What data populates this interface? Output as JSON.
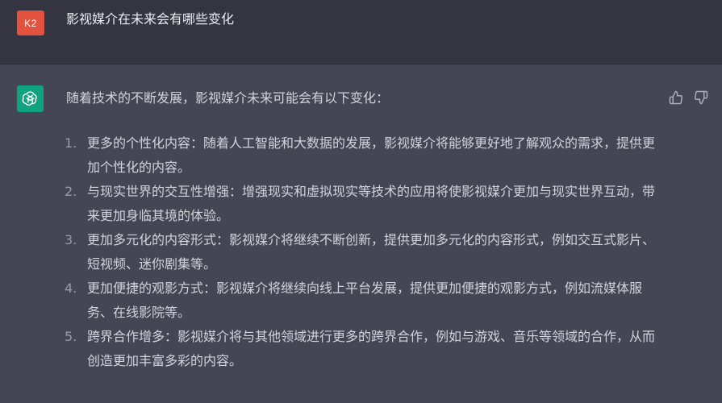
{
  "user": {
    "avatar_label": "K2",
    "message": "影视媒介在未来会有哪些变化"
  },
  "assistant": {
    "avatar_icon": "openai-logo-icon",
    "intro": "随着技术的不断发展，影视媒介未来可能会有以下变化：",
    "items": [
      {
        "num": "1.",
        "text": "更多的个性化内容：随着人工智能和大数据的发展，影视媒介将能够更好地了解观众的需求，提供更加个性化的内容。"
      },
      {
        "num": "2.",
        "text": "与现实世界的交互性增强：增强现实和虚拟现实等技术的应用将使影视媒介更加与现实世界互动，带来更加身临其境的体验。"
      },
      {
        "num": "3.",
        "text": "更加多元化的内容形式：影视媒介将继续不断创新，提供更加多元化的内容形式，例如交互式影片、短视频、迷你剧集等。"
      },
      {
        "num": "4.",
        "text": "更加便捷的观影方式：影视媒介将继续向线上平台发展，提供更加便捷的观影方式，例如流媒体服务、在线影院等。"
      },
      {
        "num": "5.",
        "text": "跨界合作增多：影视媒介将与其他领域进行更多的跨界合作，例如与游戏、音乐等领域的合作，从而创造更加丰富多彩的内容。"
      }
    ]
  },
  "feedback": {
    "up_icon": "thumbs-up-icon",
    "down_icon": "thumbs-down-icon"
  },
  "colors": {
    "user_bg": "#343541",
    "assistant_bg": "#444654",
    "user_avatar": "#e2533f",
    "assistant_avatar": "#10a37f",
    "text": "#d1d5db"
  }
}
